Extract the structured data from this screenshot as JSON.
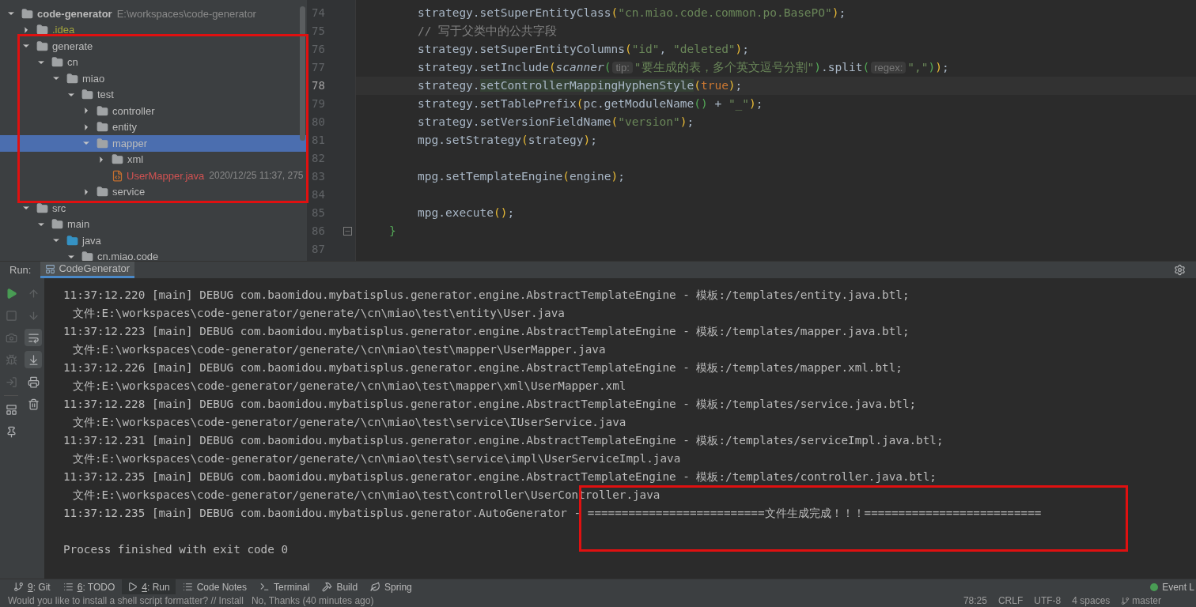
{
  "project_tree": {
    "items": [
      {
        "label": "code-generator",
        "kind": "module",
        "path": "E:\\workspaces\\code-generator",
        "expanded": true,
        "selected": false,
        "children": [
          {
            "label": ".idea",
            "kind": "config",
            "expanded": false,
            "selected": false
          },
          {
            "label": "generate",
            "kind": "folder",
            "expanded": true,
            "selected": false,
            "children": [
              {
                "label": "cn",
                "kind": "folder",
                "expanded": true,
                "selected": false,
                "children": [
                  {
                    "label": "miao",
                    "kind": "folder",
                    "expanded": true,
                    "selected": false,
                    "children": [
                      {
                        "label": "test",
                        "kind": "folder",
                        "expanded": true,
                        "selected": false,
                        "children": [
                          {
                            "label": "controller",
                            "kind": "folder",
                            "expanded": false,
                            "selected": false
                          },
                          {
                            "label": "entity",
                            "kind": "folder",
                            "expanded": false,
                            "selected": false
                          },
                          {
                            "label": "mapper",
                            "kind": "folder",
                            "expanded": true,
                            "selected": true,
                            "children": [
                              {
                                "label": "xml",
                                "kind": "folder",
                                "expanded": false,
                                "selected": false
                              },
                              {
                                "label": "UserMapper.java",
                                "kind": "file",
                                "meta": "2020/12/25 11:37, 275",
                                "selected": false
                              }
                            ]
                          },
                          {
                            "label": "service",
                            "kind": "folder",
                            "expanded": false,
                            "selected": false
                          }
                        ]
                      }
                    ]
                  }
                ]
              }
            ]
          },
          {
            "label": "src",
            "kind": "folder",
            "expanded": true,
            "selected": false,
            "children": [
              {
                "label": "main",
                "kind": "folder",
                "expanded": true,
                "selected": false,
                "children": [
                  {
                    "label": "java",
                    "kind": "source",
                    "expanded": true,
                    "selected": false,
                    "children": [
                      {
                        "label": "cn.miao.code",
                        "kind": "folder",
                        "expanded": true,
                        "selected": false
                      }
                    ]
                  }
                ]
              }
            ]
          }
        ]
      }
    ]
  },
  "editor": {
    "lines": [
      {
        "number": "74",
        "current": false,
        "fold": false,
        "tokens": [
          {
            "text": "strategy.setSuperEntityClass",
            "kind": "plain"
          },
          {
            "text": "(",
            "kind": "paren1"
          },
          {
            "text": "\"cn.miao.code.common.po.BasePO\"",
            "kind": "string"
          },
          {
            "text": ")",
            "kind": "paren1"
          },
          {
            "text": ";",
            "kind": "plain"
          }
        ]
      },
      {
        "number": "75",
        "current": false,
        "fold": false,
        "tokens": [
          {
            "text": "// 写于父类中的公共字段",
            "kind": "comment"
          }
        ]
      },
      {
        "number": "76",
        "current": false,
        "fold": false,
        "tokens": [
          {
            "text": "strategy.setSuperEntityColumns",
            "kind": "plain"
          },
          {
            "text": "(",
            "kind": "paren1"
          },
          {
            "text": "\"id\"",
            "kind": "string"
          },
          {
            "text": ", ",
            "kind": "plain"
          },
          {
            "text": "\"deleted\"",
            "kind": "string"
          },
          {
            "text": ")",
            "kind": "paren1"
          },
          {
            "text": ";",
            "kind": "plain"
          }
        ]
      },
      {
        "number": "77",
        "current": false,
        "fold": false,
        "tokens": [
          {
            "text": "strategy.setInclude",
            "kind": "plain"
          },
          {
            "text": "(",
            "kind": "paren1"
          },
          {
            "text": "scanner",
            "kind": "italic"
          },
          {
            "text": "(",
            "kind": "paren2"
          },
          {
            "text": "tip:",
            "kind": "hint"
          },
          {
            "text": "\"要生成的表，多个英文逗号分割\"",
            "kind": "string"
          },
          {
            "text": ")",
            "kind": "paren2"
          },
          {
            "text": ".split",
            "kind": "plain"
          },
          {
            "text": "(",
            "kind": "paren2"
          },
          {
            "text": "regex:",
            "kind": "hint"
          },
          {
            "text": "\",\"",
            "kind": "string"
          },
          {
            "text": ")",
            "kind": "paren2"
          },
          {
            "text": ")",
            "kind": "paren1"
          },
          {
            "text": ";",
            "kind": "plain"
          }
        ]
      },
      {
        "number": "78",
        "current": true,
        "fold": false,
        "tokens": [
          {
            "text": "strategy.",
            "kind": "plain"
          },
          {
            "text": "setControllerMappingHyphenStyle",
            "kind": "usage"
          },
          {
            "text": "(",
            "kind": "paren1"
          },
          {
            "text": "true",
            "kind": "keyword"
          },
          {
            "text": ")",
            "kind": "paren1"
          },
          {
            "text": ";",
            "kind": "plain"
          }
        ]
      },
      {
        "number": "79",
        "current": false,
        "fold": false,
        "tokens": [
          {
            "text": "strategy.setTablePrefix",
            "kind": "plain"
          },
          {
            "text": "(",
            "kind": "paren1"
          },
          {
            "text": "pc.getModuleName",
            "kind": "plain"
          },
          {
            "text": "()",
            "kind": "paren2"
          },
          {
            "text": " + ",
            "kind": "plain"
          },
          {
            "text": "\"_\"",
            "kind": "string"
          },
          {
            "text": ")",
            "kind": "paren1"
          },
          {
            "text": ";",
            "kind": "plain"
          }
        ]
      },
      {
        "number": "80",
        "current": false,
        "fold": false,
        "tokens": [
          {
            "text": "strategy.setVersionFieldName",
            "kind": "plain"
          },
          {
            "text": "(",
            "kind": "paren1"
          },
          {
            "text": "\"version\"",
            "kind": "string"
          },
          {
            "text": ")",
            "kind": "paren1"
          },
          {
            "text": ";",
            "kind": "plain"
          }
        ]
      },
      {
        "number": "81",
        "current": false,
        "fold": false,
        "tokens": [
          {
            "text": "mpg.setStrategy",
            "kind": "plain"
          },
          {
            "text": "(",
            "kind": "paren1"
          },
          {
            "text": "strategy",
            "kind": "plain"
          },
          {
            "text": ")",
            "kind": "paren1"
          },
          {
            "text": ";",
            "kind": "plain"
          }
        ]
      },
      {
        "number": "82",
        "current": false,
        "fold": false
      },
      {
        "number": "83",
        "current": false,
        "fold": false,
        "tokens": [
          {
            "text": "mpg.setTemplateEngine",
            "kind": "plain"
          },
          {
            "text": "(",
            "kind": "paren1"
          },
          {
            "text": "engine",
            "kind": "plain"
          },
          {
            "text": ")",
            "kind": "paren1"
          },
          {
            "text": ";",
            "kind": "plain"
          }
        ]
      },
      {
        "number": "84",
        "current": false,
        "fold": false
      },
      {
        "number": "85",
        "current": false,
        "fold": false,
        "tokens": [
          {
            "text": "mpg.execute",
            "kind": "plain"
          },
          {
            "text": "()",
            "kind": "paren1"
          },
          {
            "text": ";",
            "kind": "plain"
          }
        ]
      },
      {
        "number": "86",
        "current": false,
        "fold": true,
        "tokens": [
          {
            "text": "}",
            "kind": "brace"
          }
        ]
      },
      {
        "number": "87",
        "current": false,
        "fold": false
      }
    ]
  },
  "run_panel": {
    "label": "Run:",
    "tab": "CodeGenerator",
    "tools_left": [
      {
        "kind": "play",
        "disabled": false
      },
      {
        "kind": "stop",
        "disabled": true
      },
      {
        "kind": "camera",
        "disabled": true
      },
      {
        "kind": "bug",
        "disabled": true
      },
      {
        "kind": "exit",
        "disabled": true
      },
      {
        "kind": "layout",
        "disabled": false
      },
      {
        "kind": "pin",
        "disabled": false
      }
    ],
    "tools_right": [
      {
        "kind": "up",
        "selected": false,
        "disabled": true
      },
      {
        "kind": "down",
        "selected": false,
        "disabled": true
      },
      {
        "kind": "wrap",
        "selected": true,
        "disabled": false
      },
      {
        "kind": "scroll",
        "selected": true,
        "disabled": false
      },
      {
        "kind": "print",
        "selected": false,
        "disabled": false
      },
      {
        "kind": "trash",
        "selected": false,
        "disabled": false
      }
    ],
    "lines": [
      {
        "kind": "log",
        "text": "11:37:12.220 [main] DEBUG com.baomidou.mybatisplus.generator.engine.AbstractTemplateEngine - 模板:/templates/entity.java.btl;"
      },
      {
        "kind": "file",
        "text": "文件:E:\\workspaces\\code-generator/generate/\\cn\\miao\\test\\entity\\User.java"
      },
      {
        "kind": "log",
        "text": "11:37:12.223 [main] DEBUG com.baomidou.mybatisplus.generator.engine.AbstractTemplateEngine - 模板:/templates/mapper.java.btl;"
      },
      {
        "kind": "file",
        "text": "文件:E:\\workspaces\\code-generator/generate/\\cn\\miao\\test\\mapper\\UserMapper.java"
      },
      {
        "kind": "log",
        "text": "11:37:12.226 [main] DEBUG com.baomidou.mybatisplus.generator.engine.AbstractTemplateEngine - 模板:/templates/mapper.xml.btl;"
      },
      {
        "kind": "file",
        "text": "文件:E:\\workspaces\\code-generator/generate/\\cn\\miao\\test\\mapper\\xml\\UserMapper.xml"
      },
      {
        "kind": "log",
        "text": "11:37:12.228 [main] DEBUG com.baomidou.mybatisplus.generator.engine.AbstractTemplateEngine - 模板:/templates/service.java.btl;"
      },
      {
        "kind": "file",
        "text": "文件:E:\\workspaces\\code-generator/generate/\\cn\\miao\\test\\service\\IUserService.java"
      },
      {
        "kind": "log",
        "text": "11:37:12.231 [main] DEBUG com.baomidou.mybatisplus.generator.engine.AbstractTemplateEngine - 模板:/templates/serviceImpl.java.btl;"
      },
      {
        "kind": "file",
        "text": "文件:E:\\workspaces\\code-generator/generate/\\cn\\miao\\test\\service\\impl\\UserServiceImpl.java"
      },
      {
        "kind": "log",
        "text": "11:37:12.235 [main] DEBUG com.baomidou.mybatisplus.generator.engine.AbstractTemplateEngine - 模板:/templates/controller.java.btl;"
      },
      {
        "kind": "file",
        "text": "文件:E:\\workspaces\\code-generator/generate/\\cn\\miao\\test\\controller\\UserController.java"
      },
      {
        "kind": "log",
        "text": "11:37:12.235 [main] DEBUG com.baomidou.mybatisplus.generator.AutoGenerator - ==========================文件生成完成！！！=========================="
      },
      {
        "kind": "blank"
      },
      {
        "kind": "log",
        "text": "Process finished with exit code 0"
      }
    ]
  },
  "tool_tabs": [
    {
      "key": "9",
      "label": ": Git",
      "selected": false
    },
    {
      "key": "6",
      "label": ": TODO",
      "selected": false
    },
    {
      "key": "4",
      "label": ": Run",
      "selected": true
    },
    {
      "label": "Code Notes",
      "selected": false
    },
    {
      "label": "Terminal",
      "selected": false
    },
    {
      "label": "Build",
      "selected": false
    },
    {
      "label": "Spring",
      "selected": false
    }
  ],
  "event_log": {
    "label": "Event L"
  },
  "status_bar": {
    "message": "Would you like to install a shell script formatter? // Install   No, Thanks (40 minutes ago)",
    "items": [
      {
        "kind": "text",
        "text": "78:25"
      },
      {
        "kind": "text",
        "text": "CRLF"
      },
      {
        "kind": "text",
        "text": "UTF-8"
      },
      {
        "kind": "text",
        "text": "4 spaces"
      },
      {
        "kind": "branch",
        "text": "master"
      }
    ]
  }
}
